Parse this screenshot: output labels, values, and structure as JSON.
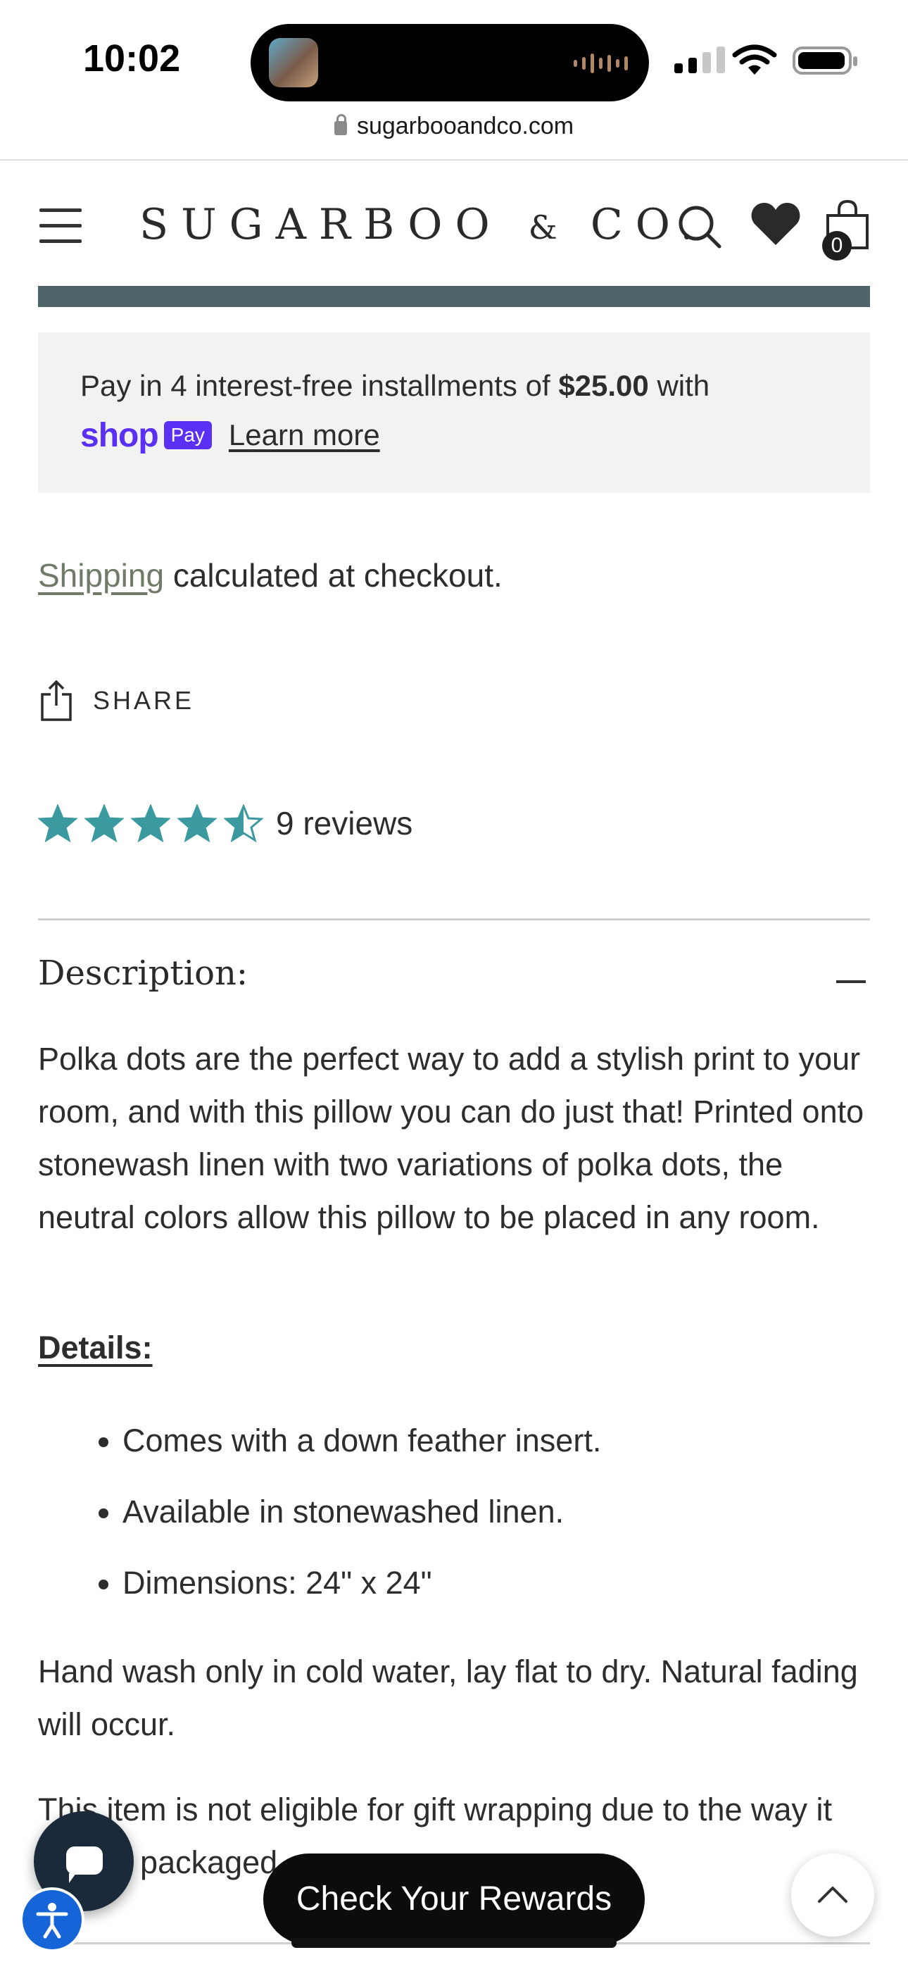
{
  "status_bar": {
    "time": "10:02",
    "url": "sugarbooandco.com"
  },
  "header": {
    "brand_main": "SUGARBOO",
    "brand_amp": "&",
    "brand_tail": "CO.",
    "cart_count": "0",
    "icons": [
      "menu-icon",
      "search-icon",
      "heart-icon",
      "shopping-bag-icon"
    ]
  },
  "shop_pay": {
    "text_before": "Pay in 4 interest-free installments of ",
    "amount": "$25.00",
    "text_after": " with",
    "shop_word": "shop",
    "pay_badge": "Pay",
    "learn_more": "Learn more"
  },
  "shipping": {
    "link": "Shipping",
    "rest": " calculated at checkout."
  },
  "share": {
    "label": "SHARE"
  },
  "rating": {
    "stars": 4.5,
    "max_stars": 5,
    "reviews": "9 reviews",
    "color": "#3a9aa0"
  },
  "description": {
    "title": "Description:",
    "body": "Polka dots are the perfect way to add a stylish print to your room, and with this pillow you can do just that! Printed onto stonewash linen with two variations of polka dots, the neutral colors allow this pillow to be placed in any room.",
    "details_label": "Details:",
    "details": [
      "Comes with a down feather insert.",
      "Available in stonewashed linen.",
      "Dimensions: 24\" x 24\""
    ],
    "care": "Hand wash only in cold water, lay flat to dry. Natural fading will occur.",
    "gift_note": "This item is not eligible for gift wrapping due to the way it comes packaged."
  },
  "floating": {
    "rewards_button": "Check Your Rewards",
    "icons": [
      "chat-icon",
      "accessibility-icon",
      "chevron-up-icon"
    ]
  },
  "colors": {
    "header_bar": "#4f6468",
    "shop_pay_purple": "#5a31f4",
    "shipping_link": "#6f7a68",
    "accessibility_blue": "#1565d8"
  }
}
